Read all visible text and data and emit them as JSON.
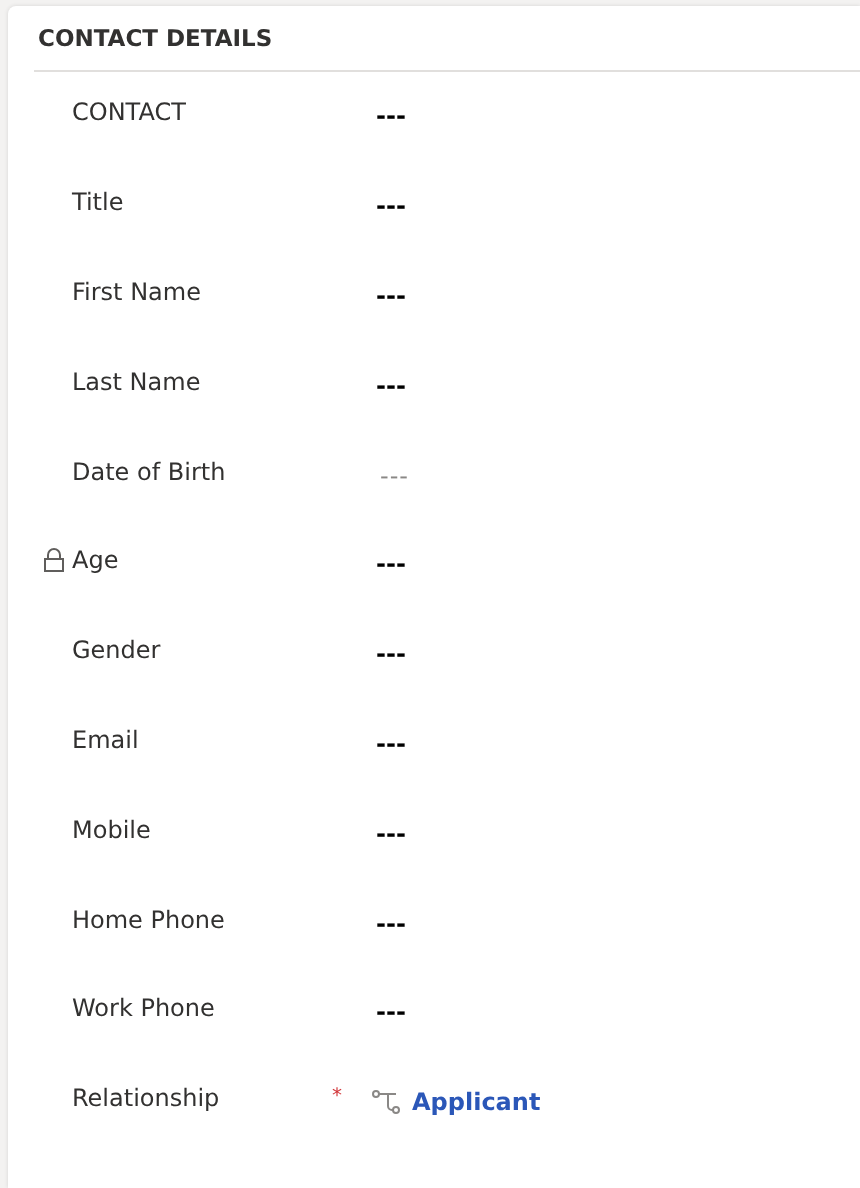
{
  "section": {
    "title": "CONTACT DETAILS"
  },
  "fields": [
    {
      "label": "CONTACT",
      "value": "---",
      "kind": "text",
      "locked": false
    },
    {
      "label": "Title",
      "value": "---",
      "kind": "text",
      "locked": false
    },
    {
      "label": "First Name",
      "value": "---",
      "kind": "text",
      "locked": false
    },
    {
      "label": "Last Name",
      "value": "---",
      "kind": "text",
      "locked": false
    },
    {
      "label": "Date of Birth",
      "placeholder": "---",
      "kind": "date",
      "locked": false
    },
    {
      "label": "Age",
      "value": "---",
      "kind": "text",
      "locked": true
    },
    {
      "label": "Gender",
      "value": "---",
      "kind": "text",
      "locked": false
    },
    {
      "label": "Email",
      "value": "---",
      "kind": "text",
      "locked": false
    },
    {
      "label": "Mobile",
      "value": "---",
      "kind": "text",
      "locked": false
    },
    {
      "label": "Home Phone",
      "value": "---",
      "kind": "text",
      "locked": false
    },
    {
      "label": "Work Phone",
      "value": "---",
      "kind": "text",
      "locked": false
    },
    {
      "label": "Relationship",
      "value": "Applicant",
      "kind": "lookup",
      "locked": false,
      "required_mark": "*"
    }
  ]
}
